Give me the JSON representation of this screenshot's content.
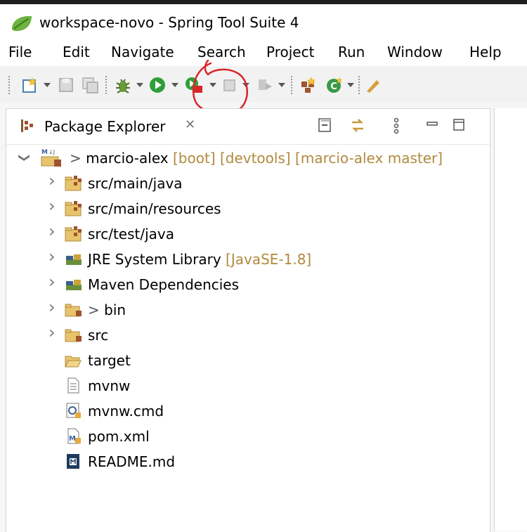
{
  "window": {
    "title": "workspace-novo - Spring Tool Suite 4"
  },
  "menu": [
    "File",
    "Edit",
    "Navigate",
    "Search",
    "Project",
    "Run",
    "Window",
    "Help"
  ],
  "view": {
    "title": "Package Explorer",
    "close_glyph": "✕"
  },
  "tree": {
    "root": {
      "prefix": "> ",
      "label": "marcio-alex",
      "decorations": " [boot] [devtools] [marcio-alex master]"
    },
    "items": [
      {
        "label": "src/main/java",
        "decoration": "",
        "icon": "source-folder-icon"
      },
      {
        "label": "src/main/resources",
        "decoration": "",
        "icon": "source-folder-icon"
      },
      {
        "label": "src/test/java",
        "decoration": "",
        "icon": "source-folder-icon"
      },
      {
        "label": "JRE System Library",
        "decoration": " [JavaSE-1.8]",
        "icon": "library-icon"
      },
      {
        "label": "Maven Dependencies",
        "decoration": "",
        "icon": "library-icon"
      },
      {
        "prefix": "> ",
        "label": "bin",
        "icon": "folder-icon"
      },
      {
        "label": "src",
        "icon": "folder-icon"
      },
      {
        "label": "target",
        "icon": "folder-open-icon"
      },
      {
        "label": "mvnw",
        "icon": "file-icon"
      },
      {
        "label": "mvnw.cmd",
        "icon": "cmd-file-icon"
      },
      {
        "label": "pom.xml",
        "icon": "maven-pom-icon"
      },
      {
        "label": "README.md",
        "icon": "markdown-file-icon"
      }
    ]
  },
  "colors": {
    "run_green": "#2f9e3a",
    "annotation_red": "#d8262b",
    "decoration_gold": "#b08a3e",
    "spring_green": "#6db33f"
  }
}
